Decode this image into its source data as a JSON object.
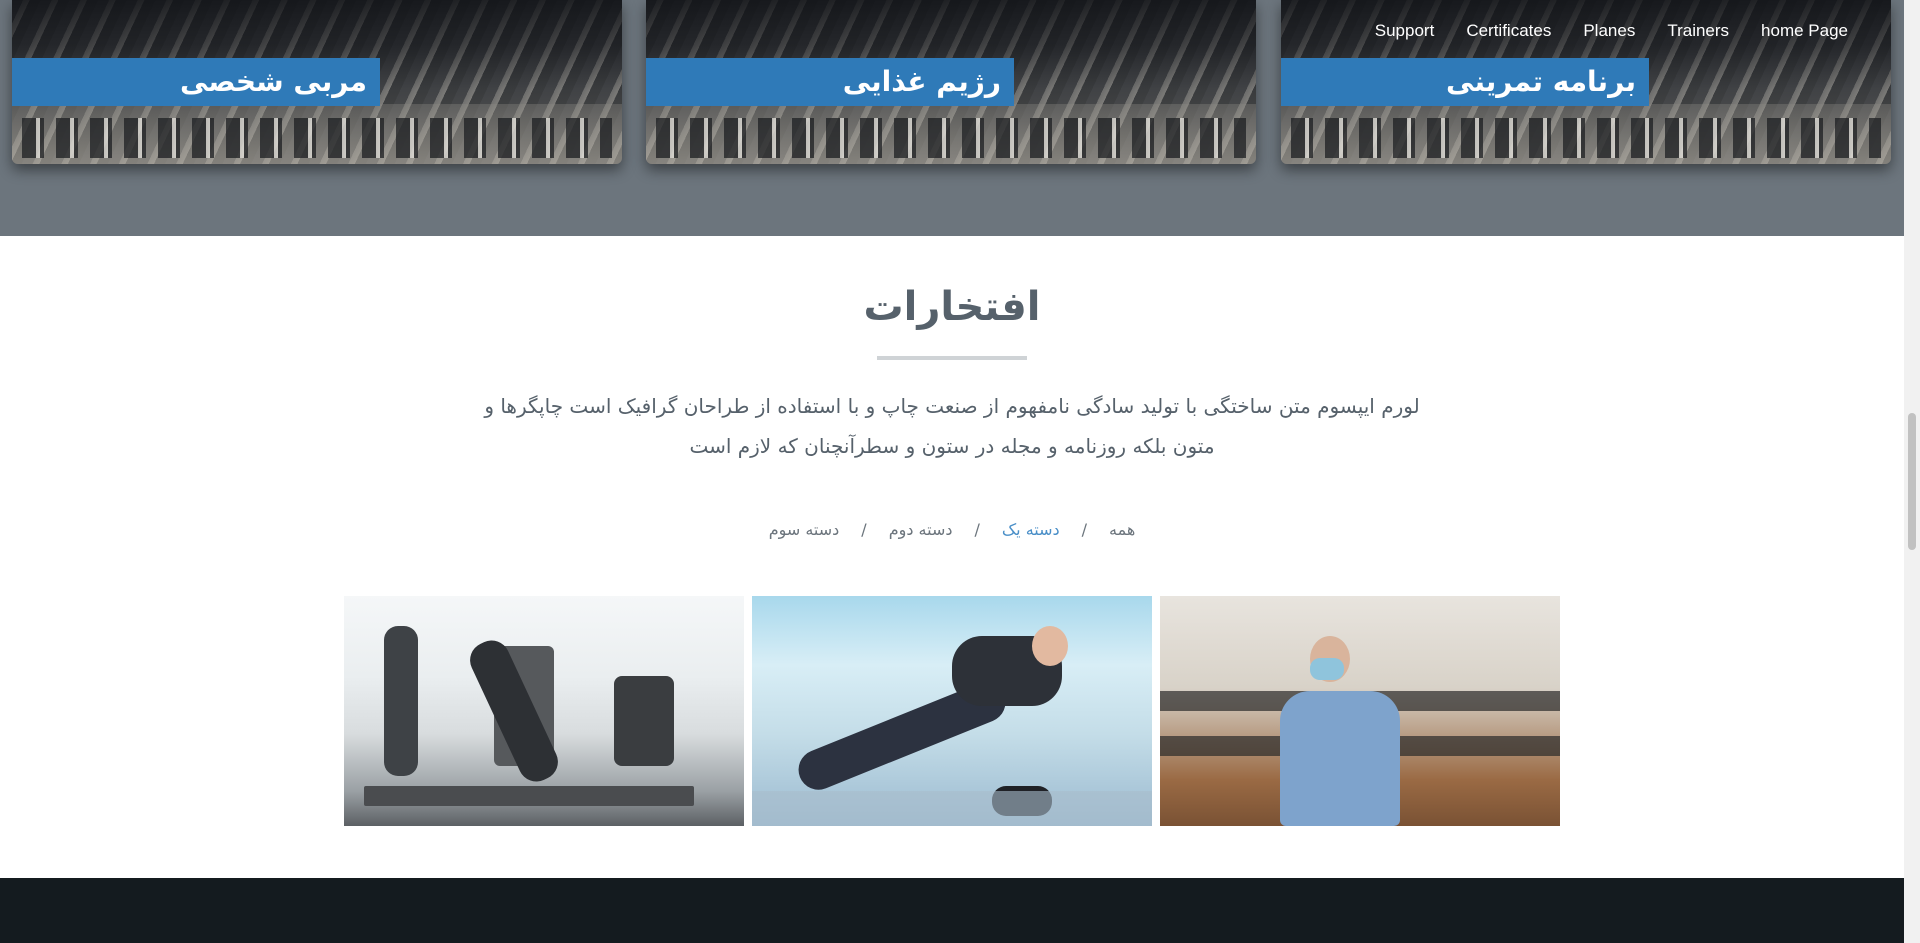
{
  "nav": {
    "items": [
      "Support",
      "Certificates",
      "Planes",
      "Trainers",
      "home Page"
    ]
  },
  "services": {
    "cards": [
      {
        "title": "مربی شخصی"
      },
      {
        "title": "رژیم غذایی"
      },
      {
        "title": "برنامه تمرینی"
      }
    ]
  },
  "achievements": {
    "title": "افتخارات",
    "description": "لورم ایپسوم متن ساختگی با تولید سادگی نامفهوم از صنعت چاپ و با استفاده از طراحان گرافیک است چاپگرها و متون بلکه روزنامه و مجله در ستون و سطرآنچنان که لازم است",
    "filters": {
      "all": "همه",
      "one": "دسته یک",
      "two": "دسته دوم",
      "three": "دسته سوم",
      "sep": "/"
    }
  },
  "colors": {
    "band": "#6c757d",
    "accent": "#2f7ab8",
    "footer": "#141b1f"
  }
}
